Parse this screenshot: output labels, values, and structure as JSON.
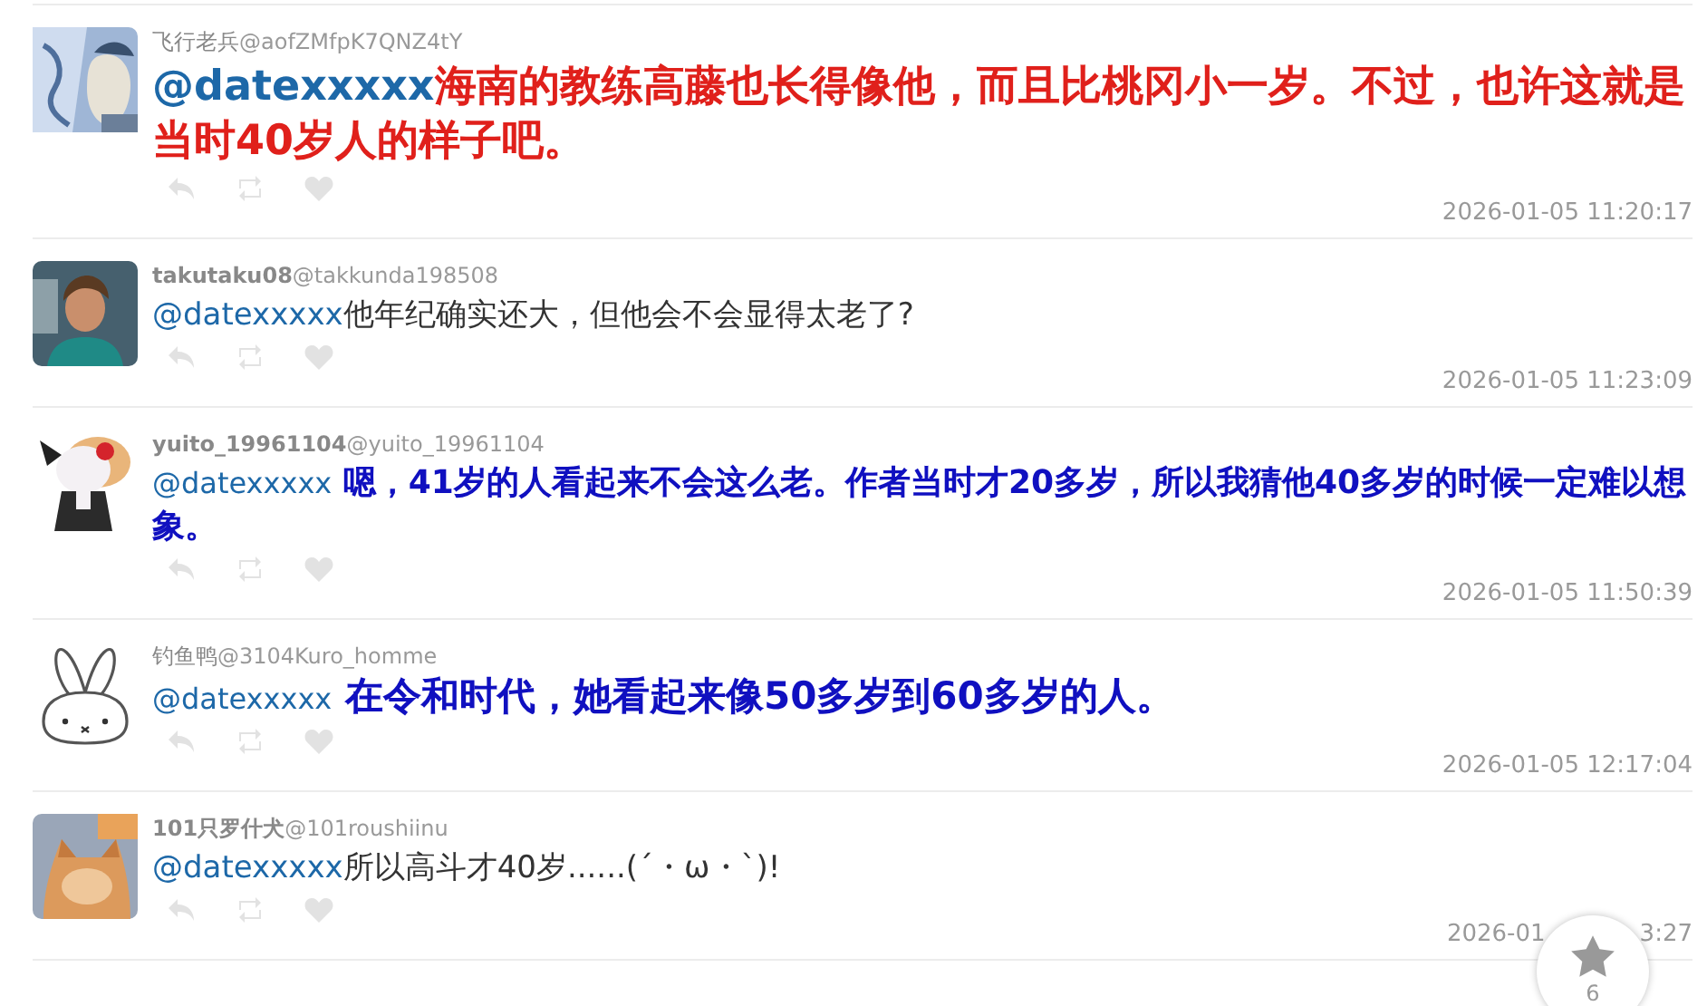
{
  "comments": [
    {
      "name": "飞行老兵",
      "handle": "@aofZMfpK7QNZ4tY",
      "name_bold": false,
      "mention": "@datexxxxx",
      "text": "海南的教练高藤也长得像他，而且比桃冈小一岁。不过，也许这就是当时40岁人的样子吧。",
      "kind": "red-bold",
      "time": "2026-01-05 11:20:17"
    },
    {
      "name": "takutaku08",
      "handle": "@takkunda198508",
      "name_bold": true,
      "mention": "@datexxxxx",
      "text": "他年纪确实还大，但他会不会显得太老了?",
      "kind": "plain",
      "time": "2026-01-05 11:23:09"
    },
    {
      "name": "yuito_19961104",
      "handle": "@yuito_19961104",
      "name_bold": true,
      "mention": "@datexxxxx",
      "text": " 嗯，41岁的人看起来不会这么老。作者当时才20多岁，所以我猜他40多岁的时候一定难以想象。",
      "kind": "blue-bold",
      "time": "2026-01-05 11:50:39"
    },
    {
      "name": "钓鱼鸭",
      "handle": "@3104Kuro_homme",
      "name_bold": false,
      "avatar": {
        "kind": "drawing"
      },
      "mention": "@datexxxxx",
      "text": " 在令和时代，她看起来像50多岁到60多岁的人。",
      "kind": "blue-bold-large",
      "time": "2026-01-05 12:17:04"
    },
    {
      "name": "101只罗什犬",
      "handle": "@101roushiinu",
      "name_bold": true,
      "mention": "@datexxxxx",
      "text": "所以高斗才40岁......(´・ω・`)!",
      "kind": "plain",
      "time": "2026-01",
      "time_tail": "3:27"
    }
  ],
  "favorite": {
    "count": "6"
  }
}
